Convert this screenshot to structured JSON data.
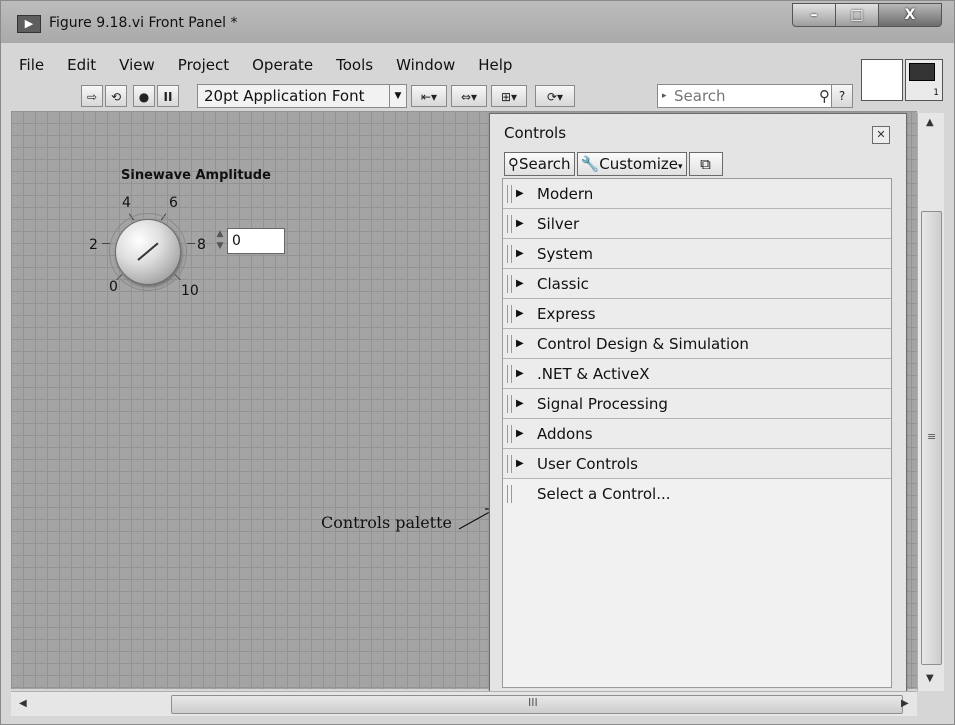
{
  "window": {
    "title": "Figure 9.18.vi Front Panel *",
    "minimize_glyph": "–",
    "maximize_glyph": "□",
    "close_glyph": "X"
  },
  "menu": [
    "File",
    "Edit",
    "View",
    "Project",
    "Operate",
    "Tools",
    "Window",
    "Help"
  ],
  "toolbar": {
    "font": "20pt Application Font",
    "search_placeholder": "Search",
    "help_glyph": "?",
    "connector_number": "1",
    "icons": [
      "run-arrow-icon",
      "run-continuously-icon",
      "abort-icon",
      "pause-icon",
      "align-icon",
      "distribute-icon",
      "resize-icon",
      "reorder-icon"
    ]
  },
  "knob": {
    "title": "Sinewave Amplitude",
    "scale_labels": [
      "0",
      "2",
      "4",
      "6",
      "8",
      "10"
    ],
    "value": "0"
  },
  "annotation": "Controls palette",
  "palette": {
    "title": "Controls",
    "search_label": "Search",
    "customize_label": "Customize",
    "categories": [
      "Modern",
      "Silver",
      "System",
      "Classic",
      "Express",
      "Control Design & Simulation",
      ".NET & ActiveX",
      "Signal Processing",
      "Addons",
      "User Controls"
    ],
    "select_control": "Select a Control..."
  },
  "scrollbar": {
    "vertical_grip": "≡",
    "horizontal_grip": "III"
  }
}
